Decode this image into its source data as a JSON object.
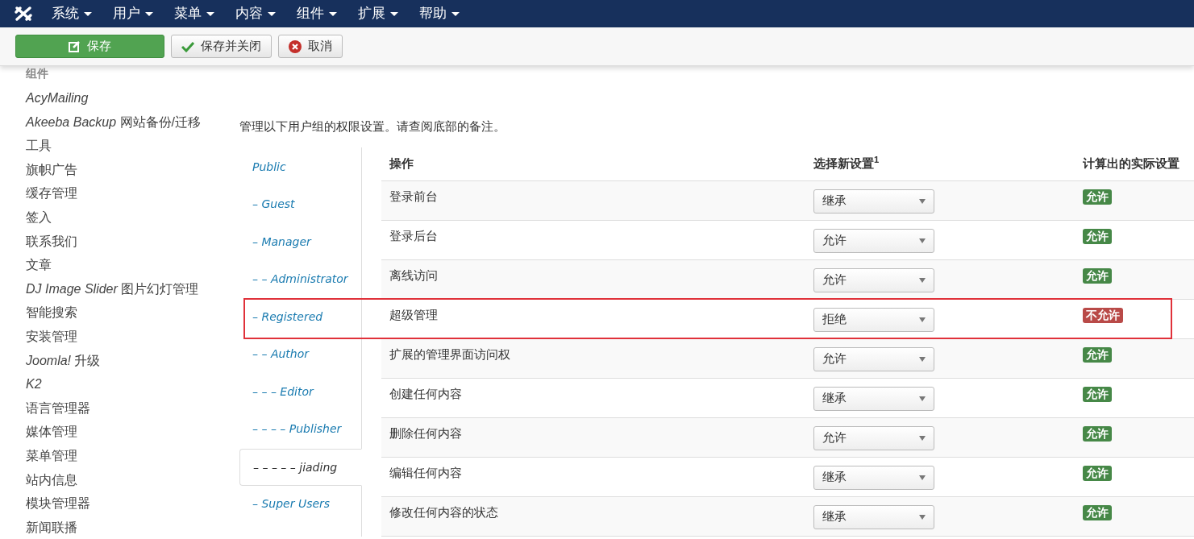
{
  "navbar": {
    "menus": [
      {
        "label": "系统"
      },
      {
        "label": "用户"
      },
      {
        "label": "菜单"
      },
      {
        "label": "内容"
      },
      {
        "label": "组件"
      },
      {
        "label": "扩展"
      },
      {
        "label": "帮助"
      }
    ]
  },
  "toolbar": {
    "buttons": [
      {
        "label": "保存",
        "kind": "save"
      },
      {
        "label": "保存并关闭",
        "kind": "check"
      },
      {
        "label": "取消",
        "kind": "cancel"
      }
    ]
  },
  "sidebar": {
    "heading": "组件",
    "items": [
      "*AcyMailing*",
      "*Akeeba Backup* 网站备份/迁移工具",
      "旗帜广告",
      "缓存管理",
      "签入",
      "联系我们",
      "文章",
      "*DJ Image Slider* 图片幻灯管理",
      "智能搜索",
      "安装管理",
      "*Joomla!* 升级",
      "*K2*",
      "语言管理器",
      "媒体管理",
      "菜单管理",
      "站内信息",
      "模块管理器",
      "新闻联播"
    ]
  },
  "intro": "管理以下用户组的权限设置。请查阅底部的备注。",
  "groups": [
    {
      "label": "Public",
      "selected": false,
      "children": [
        {
          "label": "– Guest",
          "selected": false
        },
        {
          "label": "– Manager",
          "selected": false,
          "children": [
            {
              "label": "– – Administrator",
              "selected": false
            }
          ]
        },
        {
          "label": "– Registered",
          "selected": false,
          "children": [
            {
              "label": "– – Author",
              "selected": false,
              "children": [
                {
                  "label": "– – – Editor",
                  "selected": false,
                  "children": [
                    {
                      "label": "– – – – Publisher",
                      "selected": false,
                      "children": [
                        {
                          "label": "– – – – – jiading",
                          "selected": true
                        }
                      ]
                    }
                  ]
                }
              ]
            }
          ]
        },
        {
          "label": "– Super Users",
          "selected": false
        }
      ]
    }
  ],
  "table": {
    "columns": [
      "操作",
      "选择新设置$^{1}$",
      "计算出的实际设置"
    ],
    "rows": [
      {
        "action": "登录前台",
        "setting": "继承",
        "result": "允许",
        "allowed": true,
        "highlighted": false
      },
      {
        "action": "登录后台",
        "setting": "允许",
        "result": "允许",
        "allowed": true,
        "highlighted": false
      },
      {
        "action": "离线访问",
        "setting": "允许",
        "result": "允许",
        "allowed": true,
        "highlighted": false
      },
      {
        "action": "超级管理",
        "setting": "拒绝",
        "result": "不允许",
        "allowed": false,
        "highlighted": true
      },
      {
        "action": "扩展的管理界面访问权",
        "setting": "允许",
        "result": "允许",
        "allowed": true,
        "highlighted": false
      },
      {
        "action": "创建任何内容",
        "setting": "继承",
        "result": "允许",
        "allowed": true,
        "highlighted": false
      },
      {
        "action": "删除任何内容",
        "setting": "允许",
        "result": "允许",
        "allowed": true,
        "highlighted": false
      },
      {
        "action": "编辑任何内容",
        "setting": "继承",
        "result": "允许",
        "allowed": true,
        "highlighted": false
      },
      {
        "action": "修改任何内容的状态",
        "setting": "继承",
        "result": "允许",
        "allowed": true,
        "highlighted": false
      }
    ]
  }
}
